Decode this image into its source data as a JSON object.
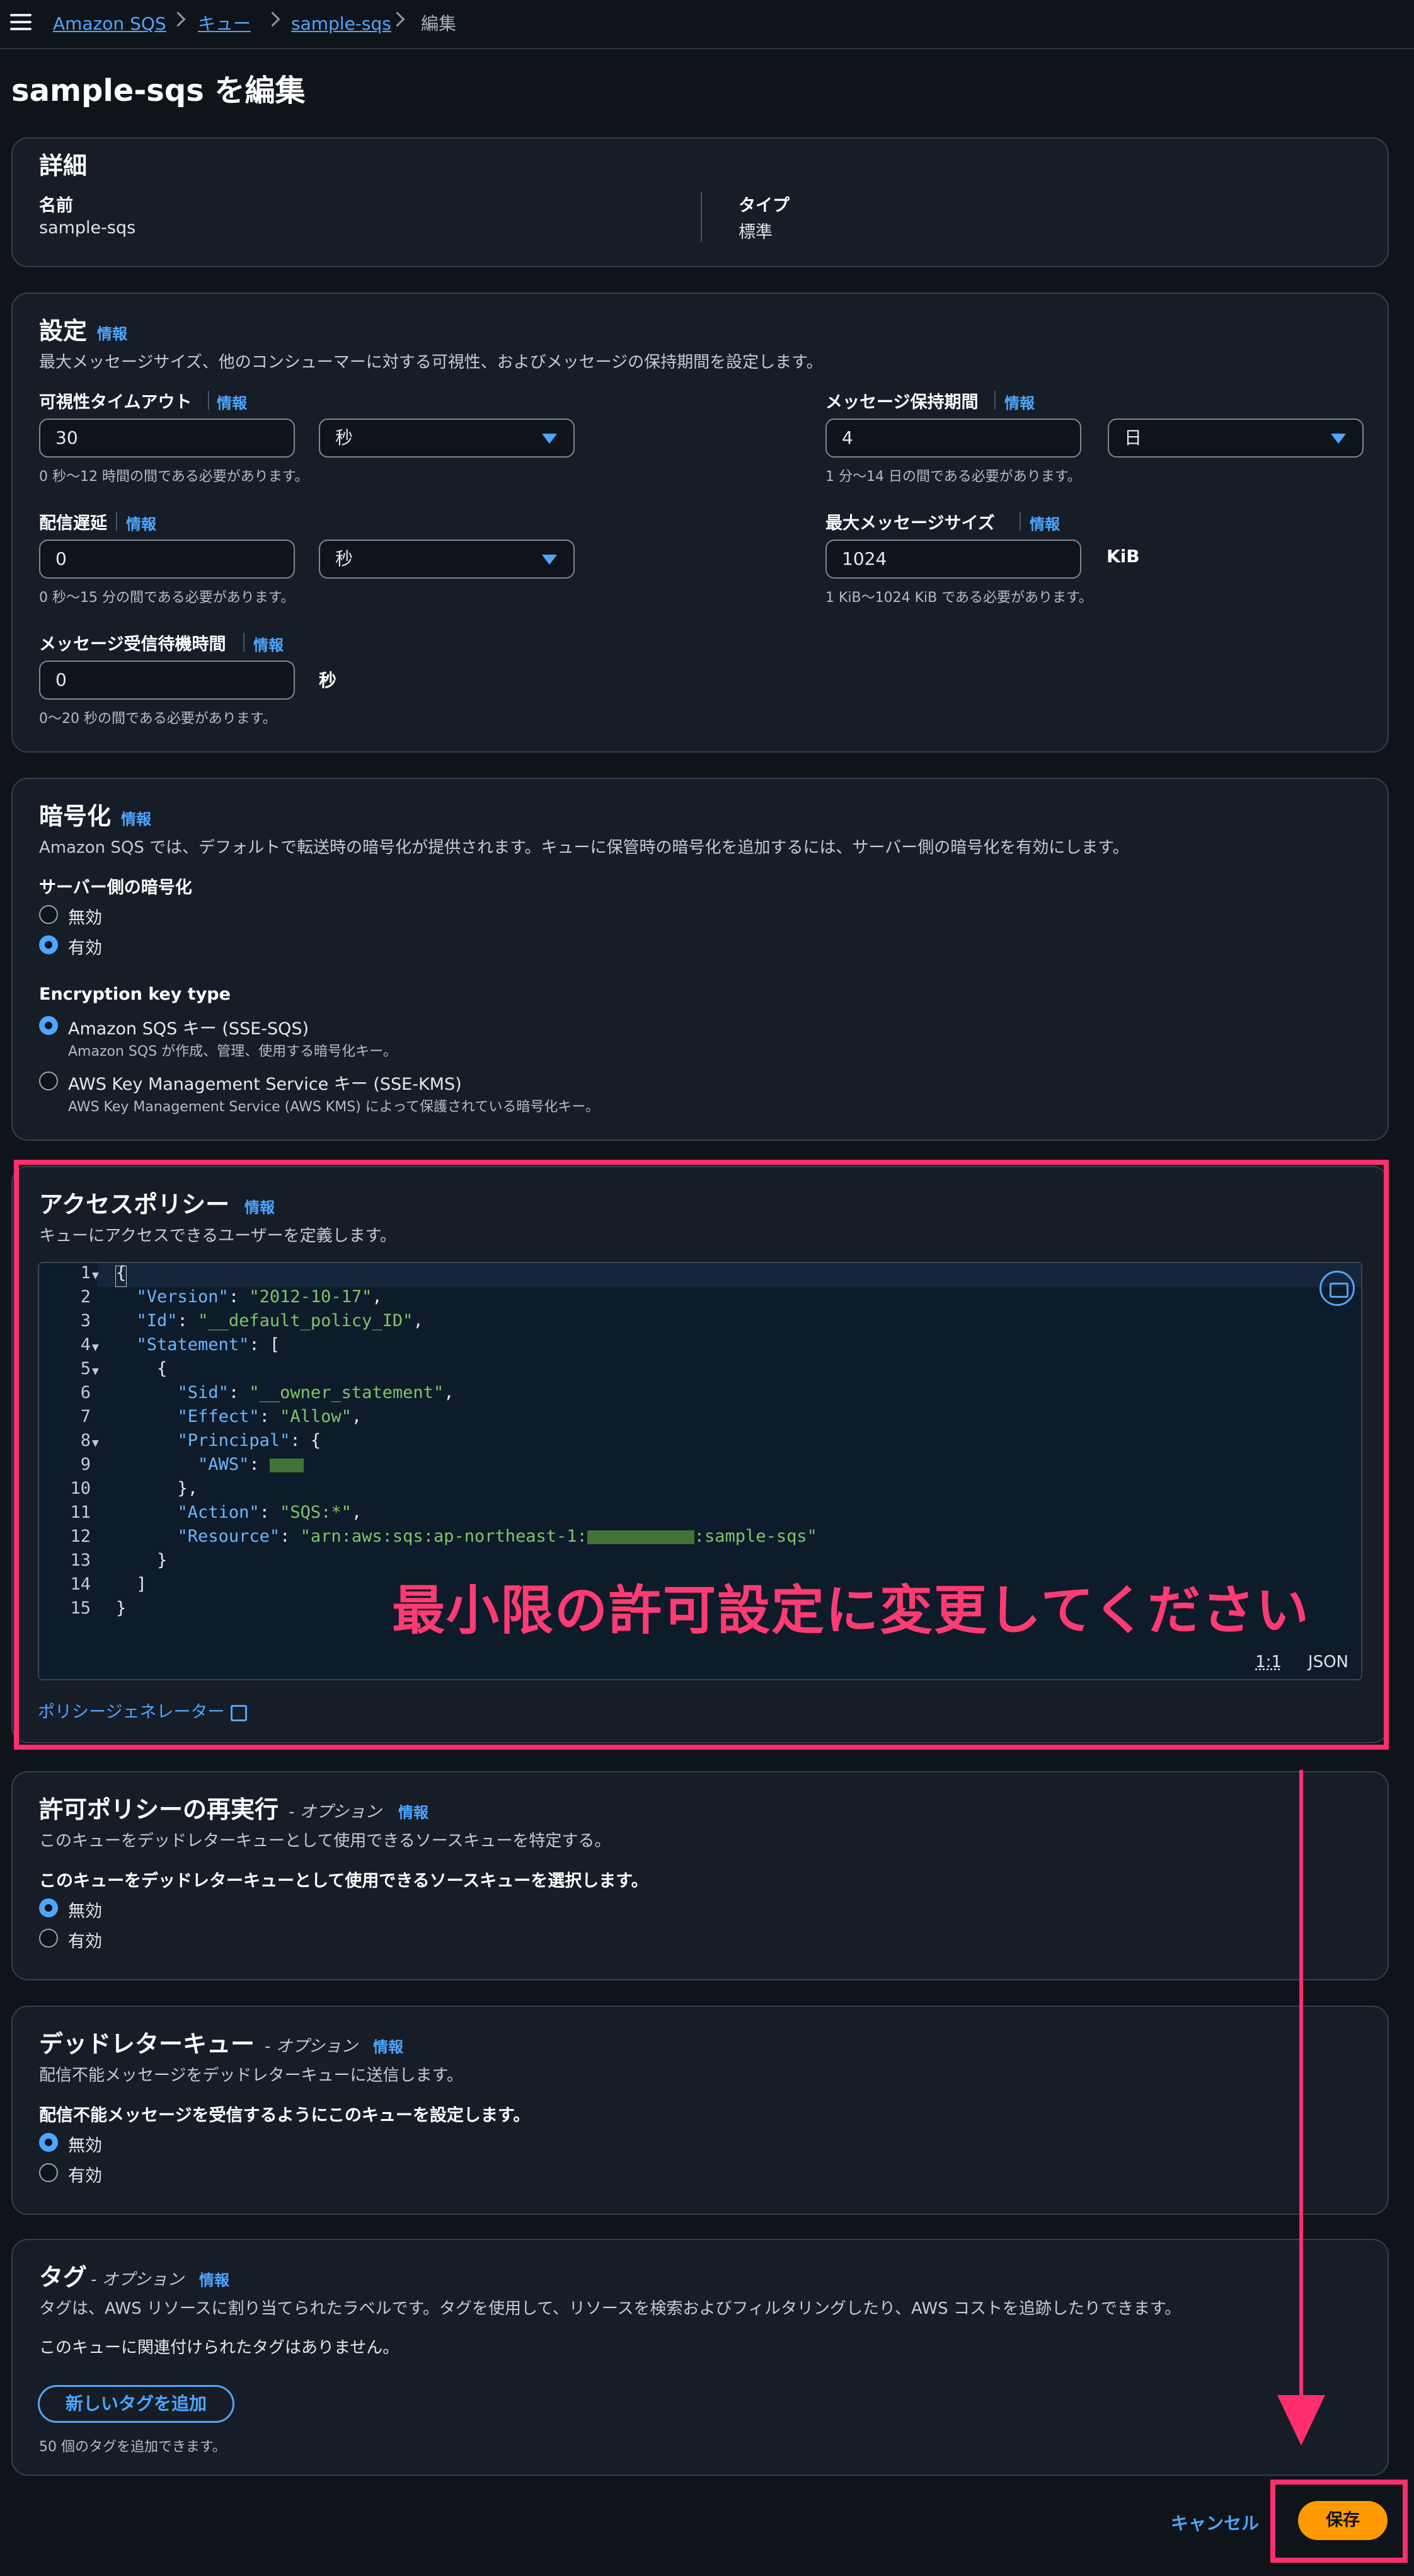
{
  "breadcrumb": {
    "items": [
      "Amazon SQS",
      "キュー",
      "sample-sqs"
    ],
    "current": "編集"
  },
  "page_title": "sample-sqs を編集",
  "details": {
    "heading": "詳細",
    "name_label": "名前",
    "name_value": "sample-sqs",
    "type_label": "タイプ",
    "type_value": "標準"
  },
  "settings": {
    "heading": "設定",
    "info": "情報",
    "description": "最大メッセージサイズ、他のコンシューマーに対する可視性、およびメッセージの保持期間を設定します。",
    "visibility_timeout": {
      "label": "可視性タイムアウト",
      "info": "情報",
      "value": "30",
      "unit": "秒",
      "hint": "0 秒〜12 時間の間である必要があります。"
    },
    "retention": {
      "label": "メッセージ保持期間",
      "info": "情報",
      "value": "4",
      "unit": "日",
      "hint": "1 分〜14 日の間である必要があります。"
    },
    "delivery_delay": {
      "label": "配信遅延",
      "info": "情報",
      "value": "0",
      "unit": "秒",
      "hint": "0 秒〜15 分の間である必要があります。"
    },
    "max_size": {
      "label": "最大メッセージサイズ",
      "info": "情報",
      "value": "1024",
      "unit": "KiB",
      "hint": "1 KiB〜1024 KiB である必要があります。"
    },
    "receive_wait": {
      "label": "メッセージ受信待機時間",
      "info": "情報",
      "value": "0",
      "unit": "秒",
      "hint": "0〜20 秒の間である必要があります。"
    }
  },
  "encryption": {
    "heading": "暗号化",
    "info": "情報",
    "description": "Amazon SQS では、デフォルトで転送時の暗号化が提供されます。キューに保管時の暗号化を追加するには、サーバー側の暗号化を有効にします。",
    "sse_label": "サーバー側の暗号化",
    "sse_options": [
      "無効",
      "有効"
    ],
    "sse_selected": "有効",
    "key_type_label": "Encryption key type",
    "key_options": [
      {
        "label": "Amazon SQS キー (SSE-SQS)",
        "desc": "Amazon SQS が作成、管理、使用する暗号化キー。"
      },
      {
        "label": "AWS Key Management Service キー (SSE-KMS)",
        "desc": "AWS Key Management Service (AWS KMS) によって保護されている暗号化キー。"
      }
    ],
    "key_selected": "Amazon SQS キー (SSE-SQS)"
  },
  "access_policy": {
    "heading": "アクセスポリシー",
    "info": "情報",
    "description": "キューにアクセスできるユーザーを定義します。",
    "line_numbers": [
      "1",
      "2",
      "3",
      "4",
      "5",
      "6",
      "7",
      "8",
      "9",
      "10",
      "11",
      "12",
      "13",
      "14",
      "15"
    ],
    "code": {
      "l1": "{",
      "version_key": "\"Version\"",
      "version_val": "\"2012-10-17\"",
      "id_key": "\"Id\"",
      "id_val": "\"__default_policy_ID\"",
      "statement_key": "\"Statement\"",
      "sid_key": "\"Sid\"",
      "sid_val": "\"__owner_statement\"",
      "effect_key": "\"Effect\"",
      "effect_val": "\"Allow\"",
      "principal_key": "\"Principal\"",
      "aws_key": "\"AWS\"",
      "action_key": "\"Action\"",
      "action_val": "\"SQS:*\"",
      "resource_key": "\"Resource\"",
      "resource_val_prefix": "\"arn:aws:sqs:ap-northeast-1:",
      "resource_val_suffix": ":sample-sqs\"",
      "l15": "}"
    },
    "cursor_pos": "1:1",
    "language": "JSON",
    "generator_link": "ポリシージェネレーター"
  },
  "annotation": {
    "overlay_text": "最小限の許可設定に変更してください",
    "color": "#ff2f6e"
  },
  "redrive_allow": {
    "heading": "許可ポリシーの再実行",
    "optional": "- オプション",
    "info": "情報",
    "description": "このキューをデッドレターキューとして使用できるソースキューを特定する。",
    "question": "このキューをデッドレターキューとして使用できるソースキューを選択します。",
    "options": [
      "無効",
      "有効"
    ],
    "selected": "無効"
  },
  "dead_letter": {
    "heading": "デッドレターキュー",
    "optional": "- オプション",
    "info": "情報",
    "description": "配信不能メッセージをデッドレターキューに送信します。",
    "question": "配信不能メッセージを受信するようにこのキューを設定します。",
    "options": [
      "無効",
      "有効"
    ],
    "selected": "無効"
  },
  "tags": {
    "heading": "タグ",
    "optional": "- オプション",
    "info": "情報",
    "description": "タグは、AWS リソースに割り当てられたラベルです。タグを使用して、リソースを検索およびフィルタリングしたり、AWS コストを追跡したりできます。",
    "empty": "このキューに関連付けられたタグはありません。",
    "add_button": "新しいタグを追加",
    "limit_hint": "50 個のタグを追加できます。"
  },
  "footer": {
    "cancel": "キャンセル",
    "save": "保存"
  },
  "colors": {
    "accent": "#4ea6ff",
    "primary_button": "#ff9900",
    "annotation": "#ff2f6e",
    "background": "#0f141a",
    "panel": "#161d26"
  }
}
